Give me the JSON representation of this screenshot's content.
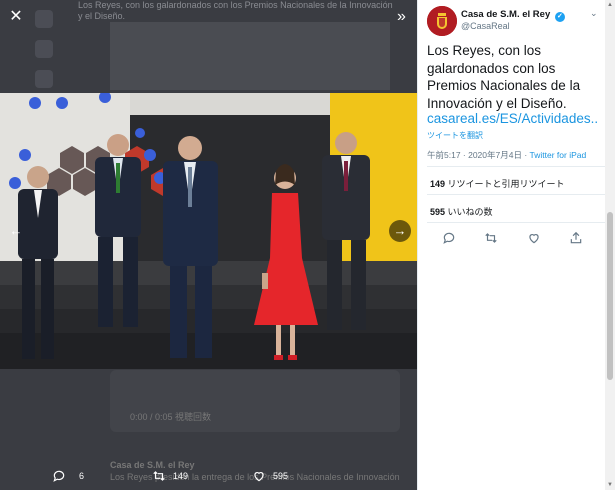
{
  "viewer": {
    "close_label": "✕",
    "collapse_label": "»",
    "prev_label": "←",
    "next_label": "→"
  },
  "background": {
    "header_text": "Los Reyes, con los galardonados con los Premios Nacionales de la Innovación y el Diseño.",
    "video_text": "0:00 / 0:05 視聴回数",
    "bottom_author": "Casa de S.M. el Rey",
    "bottom_text": "Los Reyes presiden la entrega de los Premios Nacionales de Innovación y Diseño."
  },
  "dim_actions": {
    "replies": "6",
    "retweets": "149",
    "likes": "595"
  },
  "tweet": {
    "author_name": "Casa de S.M. el Rey",
    "verified_mark": "✓",
    "handle": "@CasaReal",
    "chevron": "⌄",
    "text": "Los Reyes, con los galardonados con los Premios Nacionales de la Innovación y el Diseño.",
    "link": "casareal.es/ES/Actividades...",
    "translate": "ツイートを翻訳",
    "time": "午前5:17 · 2020年7月4日 · ",
    "source": "Twitter for iPad",
    "retweets_count": "149",
    "retweets_label": " リツイートと引用リツイート",
    "likes_count": "595",
    "likes_label": " いいねの数"
  },
  "colors": {
    "link_blue": "#1b95e0",
    "verified": "#1da1f2",
    "dim_bg": "#2b2d33"
  },
  "icons": [
    "close-icon",
    "collapse-icon",
    "prev-arrow-icon",
    "next-arrow-icon",
    "reply-icon",
    "retweet-icon",
    "like-icon",
    "share-icon",
    "verified-icon",
    "chevron-down-icon"
  ]
}
